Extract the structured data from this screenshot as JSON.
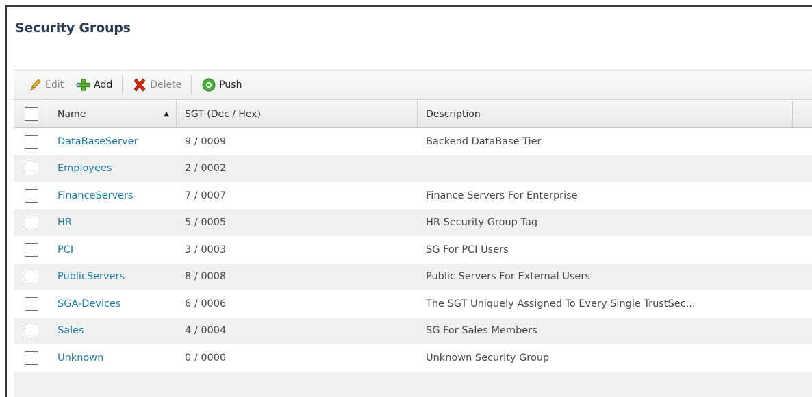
{
  "page": {
    "title": "Security Groups"
  },
  "toolbar": {
    "edit_label": "Edit",
    "add_label": "Add",
    "delete_label": "Delete",
    "push_label": "Push"
  },
  "table": {
    "columns": {
      "name": "Name",
      "sgt": "SGT (Dec / Hex)",
      "description": "Description"
    },
    "rows": [
      {
        "name": "DataBaseServer",
        "sgt": "9 / 0009",
        "description": "Backend DataBase Tier"
      },
      {
        "name": "Employees",
        "sgt": "2 / 0002",
        "description": ""
      },
      {
        "name": "FinanceServers",
        "sgt": "7 / 0007",
        "description": "Finance Servers For Enterprise"
      },
      {
        "name": "HR",
        "sgt": "5 / 0005",
        "description": "HR Security Group Tag"
      },
      {
        "name": "PCI",
        "sgt": "3 / 0003",
        "description": "SG For PCI Users"
      },
      {
        "name": "PublicServers",
        "sgt": "8 / 0008",
        "description": "Public Servers For External Users"
      },
      {
        "name": "SGA-Devices",
        "sgt": "6 / 0006",
        "description": "The SGT Uniquely Assigned To Every Single TrustSec..."
      },
      {
        "name": "Sales",
        "sgt": "4 / 0004",
        "description": "SG For Sales Members"
      },
      {
        "name": "Unknown",
        "sgt": "0 / 0000",
        "description": "Unknown Security Group"
      }
    ]
  },
  "colors": {
    "link": "#1f7fa6",
    "title": "#2a3a55",
    "alt_row": "#f0f0f0"
  },
  "icons": {
    "edit": "pencil-icon",
    "add": "plus-icon",
    "delete": "x-icon",
    "push": "push-icon",
    "sort": "sort-ascending-icon"
  }
}
